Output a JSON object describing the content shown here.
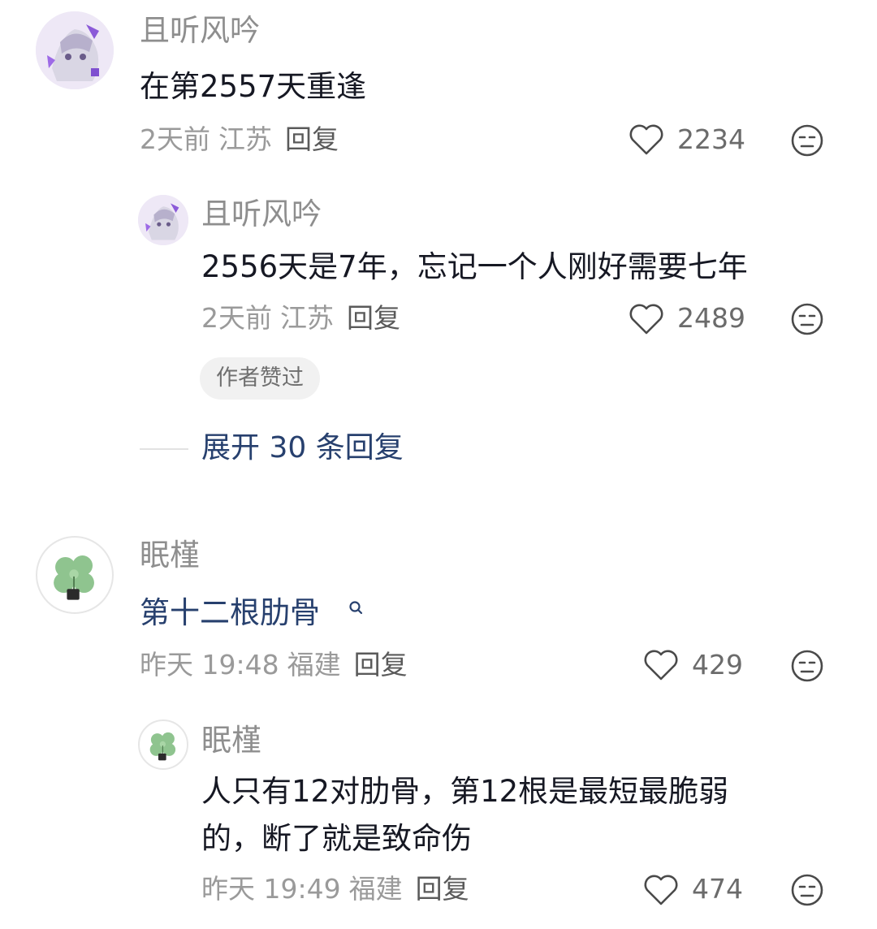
{
  "comments": [
    {
      "username": "且听风吟",
      "text": "在第2557天重逢",
      "time": "2天前",
      "location": "江苏",
      "reply_label": "回复",
      "likes": "2234",
      "replies": [
        {
          "username": "且听风吟",
          "text": "2556天是7年，忘记一个人刚好需要七年",
          "time": "2天前",
          "location": "江苏",
          "reply_label": "回复",
          "likes": "2489",
          "badge": "作者赞过"
        }
      ],
      "expand_label": "展开 30 条回复"
    },
    {
      "username": "眠槿",
      "text": "第十二根肋骨",
      "time": "昨天 19:48",
      "location": "福建",
      "reply_label": "回复",
      "likes": "429",
      "replies": [
        {
          "username": "眠槿",
          "text_line1": "人只有12对肋骨，第12根是最短最脆弱",
          "text_line2": "的，断了就是致命伤",
          "time": "昨天 19:49",
          "location": "福建",
          "reply_label": "回复",
          "likes": "474"
        }
      ]
    }
  ],
  "icons": {
    "like": "heart-outline-icon",
    "emoji": "unamused-face-icon",
    "search": "search-icon"
  },
  "colors": {
    "link": "#27406e",
    "username": "#8e8e8e",
    "text": "#161823",
    "meta": "#9a9a9a"
  }
}
